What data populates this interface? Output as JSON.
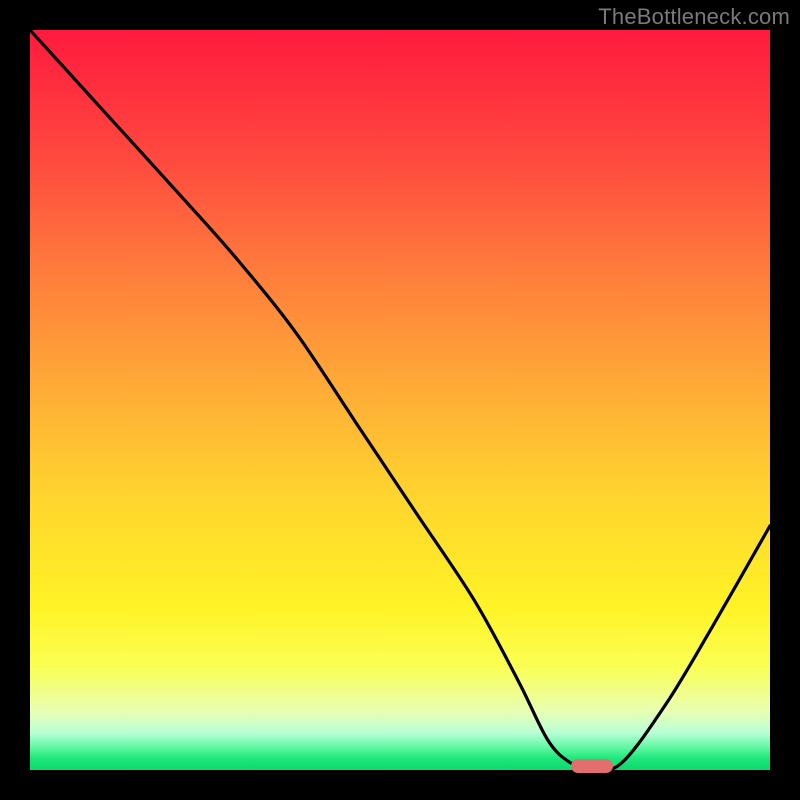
{
  "attribution": "TheBottleneck.com",
  "colors": {
    "frame": "#000000",
    "gradient_top": "#ff1a3e",
    "gradient_bottom": "#0fd96e",
    "curve": "#000000",
    "marker": "#e26e6e"
  },
  "chart_data": {
    "type": "line",
    "title": "",
    "xlabel": "",
    "ylabel": "",
    "xlim": [
      0,
      100
    ],
    "ylim": [
      0,
      100
    ],
    "grid": false,
    "legend": false,
    "series": [
      {
        "name": "bottleneck-curve",
        "x": [
          0,
          10,
          20,
          28,
          36,
          44,
          52,
          60,
          66,
          70,
          73,
          76,
          80,
          86,
          92,
          100
        ],
        "values": [
          100,
          89,
          78,
          69,
          59,
          47,
          35,
          23,
          12,
          4,
          1,
          0,
          1,
          9,
          19,
          33
        ]
      }
    ],
    "annotations": [
      {
        "name": "optimal-marker",
        "x": 76,
        "y": 0,
        "shape": "pill"
      }
    ]
  }
}
